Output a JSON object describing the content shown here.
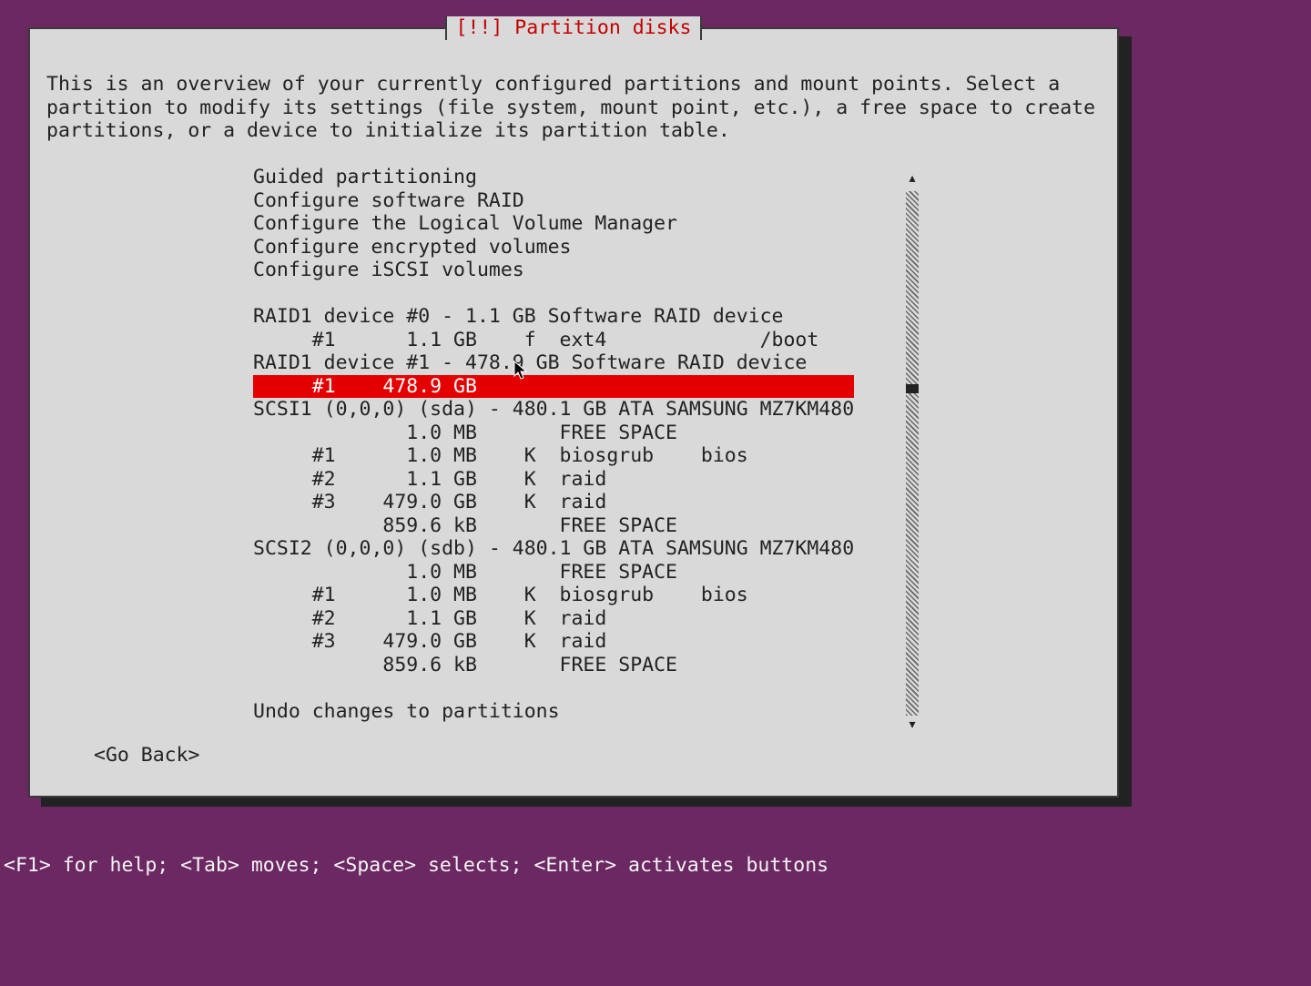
{
  "colors": {
    "background": "#6b2862",
    "panel": "#d9d9d9",
    "border": "#3a3a3a",
    "title": "#c40000",
    "selected_bg": "#e50000",
    "selected_fg": "#ffffff",
    "text": "#222222",
    "help_fg": "#f5f5f5"
  },
  "dialog": {
    "title": "[!!] Partition disks",
    "intro": "This is an overview of your currently configured partitions and mount points. Select a partition to modify its settings (file system, mount point, etc.), a free space to create partitions, or a device to initialize its partition table."
  },
  "menu": {
    "items": [
      {
        "text": "Guided partitioning",
        "selected": false,
        "indent": 0,
        "blank": false
      },
      {
        "text": "Configure software RAID",
        "selected": false,
        "indent": 0,
        "blank": false
      },
      {
        "text": "Configure the Logical Volume Manager",
        "selected": false,
        "indent": 0,
        "blank": false
      },
      {
        "text": "Configure encrypted volumes",
        "selected": false,
        "indent": 0,
        "blank": false
      },
      {
        "text": "Configure iSCSI volumes",
        "selected": false,
        "indent": 0,
        "blank": false
      },
      {
        "text": "",
        "selected": false,
        "indent": 0,
        "blank": true
      },
      {
        "text": "RAID1 device #0 - 1.1 GB Software RAID device",
        "selected": false,
        "indent": 0,
        "blank": false
      },
      {
        "text": "     #1      1.1 GB    f  ext4             /boot",
        "selected": false,
        "indent": 0,
        "blank": false
      },
      {
        "text": "RAID1 device #1 - 478.9 GB Software RAID device",
        "selected": false,
        "indent": 0,
        "blank": false
      },
      {
        "text": "     #1    478.9 GB",
        "selected": true,
        "indent": 0,
        "blank": false
      },
      {
        "text": "SCSI1 (0,0,0) (sda) - 480.1 GB ATA SAMSUNG MZ7KM480",
        "selected": false,
        "indent": 0,
        "blank": false
      },
      {
        "text": "             1.0 MB       FREE SPACE",
        "selected": false,
        "indent": 0,
        "blank": false
      },
      {
        "text": "     #1      1.0 MB    K  biosgrub    bios",
        "selected": false,
        "indent": 0,
        "blank": false
      },
      {
        "text": "     #2      1.1 GB    K  raid",
        "selected": false,
        "indent": 0,
        "blank": false
      },
      {
        "text": "     #3    479.0 GB    K  raid",
        "selected": false,
        "indent": 0,
        "blank": false
      },
      {
        "text": "           859.6 kB       FREE SPACE",
        "selected": false,
        "indent": 0,
        "blank": false
      },
      {
        "text": "SCSI2 (0,0,0) (sdb) - 480.1 GB ATA SAMSUNG MZ7KM480",
        "selected": false,
        "indent": 0,
        "blank": false
      },
      {
        "text": "             1.0 MB       FREE SPACE",
        "selected": false,
        "indent": 0,
        "blank": false
      },
      {
        "text": "     #1      1.0 MB    K  biosgrub    bios",
        "selected": false,
        "indent": 0,
        "blank": false
      },
      {
        "text": "     #2      1.1 GB    K  raid",
        "selected": false,
        "indent": 0,
        "blank": false
      },
      {
        "text": "     #3    479.0 GB    K  raid",
        "selected": false,
        "indent": 0,
        "blank": false
      },
      {
        "text": "           859.6 kB       FREE SPACE",
        "selected": false,
        "indent": 0,
        "blank": false
      },
      {
        "text": "",
        "selected": false,
        "indent": 0,
        "blank": true
      },
      {
        "text": "Undo changes to partitions",
        "selected": false,
        "indent": 0,
        "blank": false
      }
    ]
  },
  "go_back": "<Go Back>",
  "help_bar": "<F1> for help; <Tab> moves; <Space> selects; <Enter> activates buttons",
  "scroll": {
    "up_arrow": "▴",
    "down_arrow": "▾"
  }
}
